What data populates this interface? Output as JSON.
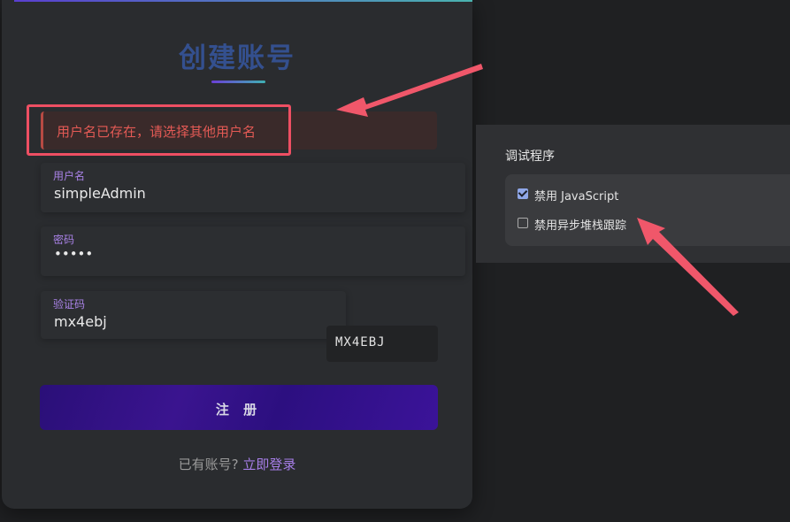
{
  "register": {
    "title": "创建账号",
    "error_message": "用户名已存在，请选择其他用户名",
    "username_label": "用户名",
    "username_value": "simpleAdmin",
    "password_label": "密码",
    "password_value": "•••••",
    "captcha_label": "验证码",
    "captcha_value": "mx4ebj",
    "captcha_image_text": "MX4EBJ",
    "submit_label": "注 册",
    "login_prompt": "已有账号?",
    "login_link": "立即登录"
  },
  "debugger": {
    "title": "调试程序",
    "options": [
      {
        "label": "禁用 JavaScript",
        "checked": true
      },
      {
        "label": "禁用异步堆栈跟踪",
        "checked": false
      }
    ]
  },
  "colors": {
    "accent_purple": "#a77ee8",
    "error_red": "#e45a55",
    "highlight_red": "#ee4f63",
    "checkbox_blue": "#8fa7e8"
  }
}
